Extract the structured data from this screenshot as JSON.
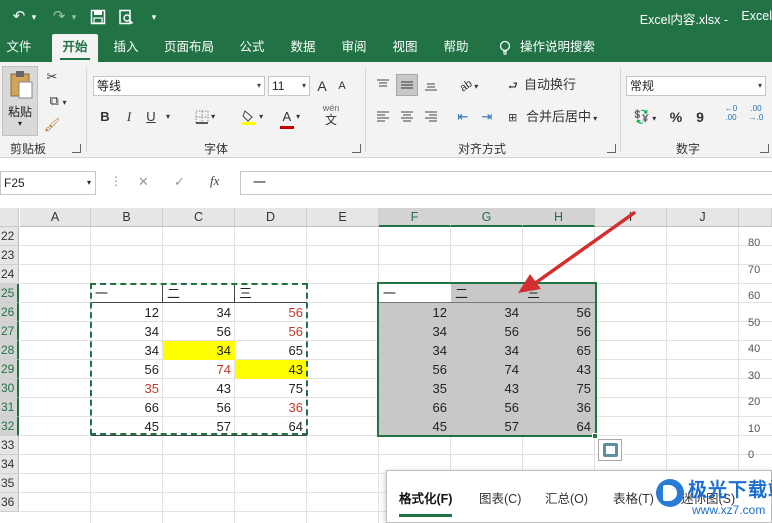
{
  "app": {
    "document_title": "Excel内容.xlsx  -",
    "app_name": "Excel"
  },
  "qat": {
    "undo_icon": "↶",
    "redo_icon": "↷",
    "save_icon": "save-icon",
    "dropdown_icon": "▾"
  },
  "tabs": [
    "文件",
    "开始",
    "插入",
    "页面布局",
    "公式",
    "数据",
    "审阅",
    "视图",
    "帮助"
  ],
  "active_tab": "开始",
  "tell_me": "操作说明搜索",
  "ribbon": {
    "clipboard": {
      "paste_label": "粘贴",
      "group_label": "剪贴板"
    },
    "font": {
      "font_name": "等线",
      "font_size": "11",
      "grow": "A",
      "shrink": "A",
      "bold": "B",
      "italic": "I",
      "underline": "U",
      "font_color_letter": "A",
      "fill_color": "#ffff00",
      "font_color": "#c00000",
      "phonetic": "wén",
      "group_label": "字体"
    },
    "alignment": {
      "wrap_text": "自动换行",
      "merge_center": "合并后居中",
      "group_label": "对齐方式"
    },
    "number": {
      "format": "常规",
      "percent": "%",
      "comma": "9",
      "inc_decimal": ".00\n+.0",
      "group_label": "数字"
    }
  },
  "formula_bar": {
    "name_box": "F25",
    "cancel": "✕",
    "enter": "✓",
    "fx": "fx",
    "content": "一"
  },
  "columns": [
    "A",
    "B",
    "C",
    "D",
    "E",
    "F",
    "G",
    "H",
    "I",
    "J"
  ],
  "selected_columns": [
    "F",
    "G",
    "H"
  ],
  "rows": [
    "22",
    "23",
    "24",
    "25",
    "26",
    "27",
    "28",
    "29",
    "30",
    "31",
    "32",
    "33",
    "34",
    "35",
    "36"
  ],
  "selected_rows": [
    "25",
    "26",
    "27",
    "28",
    "29",
    "30",
    "31",
    "32"
  ],
  "left_table": {
    "headers": [
      "一",
      "二",
      "三"
    ],
    "rows": [
      [
        12,
        34,
        56
      ],
      [
        34,
        56,
        56
      ],
      [
        34,
        34,
        65
      ],
      [
        56,
        74,
        43
      ],
      [
        35,
        43,
        75
      ],
      [
        66,
        56,
        36
      ],
      [
        45,
        57,
        64
      ]
    ],
    "highlight_yellow": [
      [
        2,
        1
      ],
      [
        3,
        2
      ]
    ],
    "red_text": [
      [
        0,
        2
      ],
      [
        1,
        2
      ],
      [
        3,
        1
      ],
      [
        4,
        0
      ],
      [
        5,
        2
      ]
    ]
  },
  "right_table": {
    "headers": [
      "一",
      "二",
      "三"
    ],
    "rows": [
      [
        12,
        34,
        56
      ],
      [
        34,
        56,
        56
      ],
      [
        34,
        34,
        65
      ],
      [
        56,
        74,
        43
      ],
      [
        35,
        43,
        75
      ],
      [
        66,
        56,
        36
      ],
      [
        45,
        57,
        64
      ]
    ]
  },
  "axis_labels": [
    "80",
    "70",
    "60",
    "50",
    "40",
    "30",
    "20",
    "10",
    "0"
  ],
  "quick_analysis": {
    "tabs": [
      "格式化(F)",
      "图表(C)",
      "汇总(O)",
      "表格(T)",
      "迷你图(S)"
    ],
    "active": "格式化(F)"
  },
  "watermark": {
    "text": "极光下载站",
    "url": "www.xz7.com"
  },
  "colors": {
    "excel_green": "#217346",
    "arrow_red": "#d32f2f",
    "selection_gray": "#c8c8c8"
  }
}
